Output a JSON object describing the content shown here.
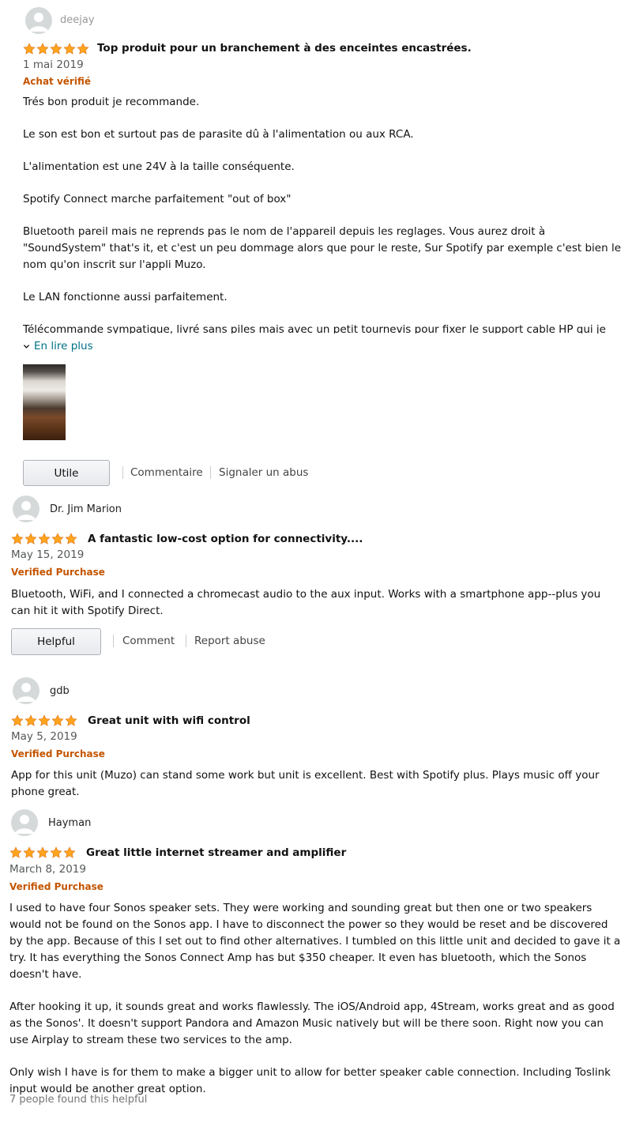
{
  "reviews": [
    {
      "author": "deejay",
      "title": "Top produit pour un branchement à des enceintes encastrées.",
      "date": "1 mai 2019",
      "verified": "Achat vérifié",
      "paragraphs": [
        "Trés bon produit je recommande.",
        "Le son est bon et surtout pas de parasite dû à l'alimentation ou aux RCA.",
        "L'alimentation est une 24V à la taille conséquente.",
        "Spotify Connect marche parfaitement \"out of box\"",
        "Bluetooth pareil mais ne reprends pas le nom de l'appareil depuis les reglages. Vous aurez droit à \"SoundSystem\" that's it, et c'est un peu dommage alors que pour le reste, Sur Spotify par exemple c'est bien le nom qu'on inscrit sur l'appli Muzo.",
        "Le LAN fonctionne aussi parfaitement.",
        "Télécommande sympatique, livré sans piles mais avec un petit tournevis pour fixer le support cable HP qui je trouve"
      ],
      "read_more": "En lire plus",
      "helpful_button": "Utile",
      "comment": "Commentaire",
      "report": "Signaler un abus",
      "rating": 5
    },
    {
      "author": "Dr. Jim Marion",
      "title": "A fantastic low-cost option for connectivity....",
      "date": "May 15, 2019",
      "verified": "Verified Purchase",
      "paragraphs": [
        "Bluetooth, WiFi, and I connected a chromecast audio to the aux input. Works with a smartphone app--plus you can hit it with Spotify Direct."
      ],
      "helpful_button": "Helpful",
      "comment": "Comment",
      "report": "Report abuse",
      "rating": 5
    },
    {
      "author": "gdb",
      "title": "Great unit with wifi control",
      "date": "May 5, 2019",
      "verified": "Verified Purchase",
      "paragraphs": [
        "App for this unit (Muzo) can stand some work but unit is excellent. Best with Spotify plus. Plays music off your phone great."
      ],
      "rating": 5
    },
    {
      "author": "Hayman",
      "title": "Great little internet streamer and amplifier",
      "date": "March 8, 2019",
      "verified": "Verified Purchase",
      "paragraphs": [
        "I used to have four Sonos speaker sets. They were working and sounding great but then one or two speakers would not be found on the Sonos app. I have to disconnect the power so they would be reset and be discovered by the app. Because of this I set out to find other alternatives. I tumbled on this little unit and decided to gave it a try. It has everything the Sonos Connect Amp has but $350 cheaper. It even has bluetooth, which the Sonos doesn't have.",
        "After hooking it up, it sounds great and works flawlessly. The iOS/Android app, 4Stream, works great and as good as the Sonos'. It doesn't support Pandora and Amazon Music natively but will be there soon. Right now you can use Airplay to stream these two services to the amp.",
        "Only wish I have is for them to make a bigger unit to allow for better speaker cable connection. Including Toslink input would be another great option."
      ],
      "helpful_count": "7 people found this helpful",
      "rating": 5
    }
  ],
  "colors": {
    "star": "#ffa41c",
    "verified": "#c45500",
    "link": "#007185"
  }
}
